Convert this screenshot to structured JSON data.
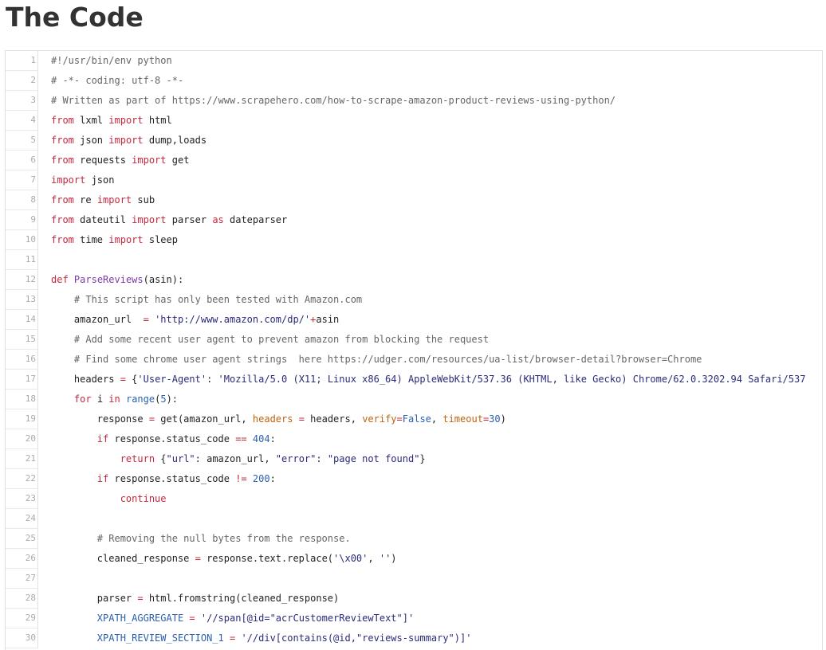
{
  "page": {
    "title": "The Code"
  },
  "code": {
    "lines": [
      {
        "n": "1",
        "tokens": [
          {
            "t": "cm",
            "v": "#!/usr/bin/env python"
          }
        ]
      },
      {
        "n": "2",
        "tokens": [
          {
            "t": "cm",
            "v": "# -*- coding: utf-8 -*-"
          }
        ]
      },
      {
        "n": "3",
        "tokens": [
          {
            "t": "cm",
            "v": "# Written as part of https://www.scrapehero.com/how-to-scrape-amazon-product-reviews-using-python/"
          }
        ]
      },
      {
        "n": "4",
        "tokens": [
          {
            "t": "kw",
            "v": "from"
          },
          {
            "t": "plain",
            "v": " lxml "
          },
          {
            "t": "kw",
            "v": "import"
          },
          {
            "t": "plain",
            "v": " html"
          }
        ]
      },
      {
        "n": "5",
        "tokens": [
          {
            "t": "kw",
            "v": "from"
          },
          {
            "t": "plain",
            "v": " json "
          },
          {
            "t": "kw",
            "v": "import"
          },
          {
            "t": "plain",
            "v": " dump,loads"
          }
        ]
      },
      {
        "n": "6",
        "tokens": [
          {
            "t": "kw",
            "v": "from"
          },
          {
            "t": "plain",
            "v": " requests "
          },
          {
            "t": "kw",
            "v": "import"
          },
          {
            "t": "plain",
            "v": " get"
          }
        ]
      },
      {
        "n": "7",
        "tokens": [
          {
            "t": "kw",
            "v": "import"
          },
          {
            "t": "plain",
            "v": " json"
          }
        ]
      },
      {
        "n": "8",
        "tokens": [
          {
            "t": "kw",
            "v": "from"
          },
          {
            "t": "plain",
            "v": " re "
          },
          {
            "t": "kw",
            "v": "import"
          },
          {
            "t": "plain",
            "v": " sub"
          }
        ]
      },
      {
        "n": "9",
        "tokens": [
          {
            "t": "kw",
            "v": "from"
          },
          {
            "t": "plain",
            "v": " dateutil "
          },
          {
            "t": "kw",
            "v": "import"
          },
          {
            "t": "plain",
            "v": " parser "
          },
          {
            "t": "kw",
            "v": "as"
          },
          {
            "t": "plain",
            "v": " dateparser"
          }
        ]
      },
      {
        "n": "10",
        "tokens": [
          {
            "t": "kw",
            "v": "from"
          },
          {
            "t": "plain",
            "v": " time "
          },
          {
            "t": "kw",
            "v": "import"
          },
          {
            "t": "plain",
            "v": " sleep"
          }
        ]
      },
      {
        "n": "11",
        "tokens": []
      },
      {
        "n": "12",
        "tokens": [
          {
            "t": "kw",
            "v": "def"
          },
          {
            "t": "plain",
            "v": " "
          },
          {
            "t": "fn",
            "v": "ParseReviews"
          },
          {
            "t": "plain",
            "v": "(asin):"
          }
        ]
      },
      {
        "n": "13",
        "tokens": [
          {
            "t": "plain",
            "v": "    "
          },
          {
            "t": "cm",
            "v": "# This script has only been tested with Amazon.com"
          }
        ]
      },
      {
        "n": "14",
        "tokens": [
          {
            "t": "plain",
            "v": "    amazon_url  "
          },
          {
            "t": "op",
            "v": "="
          },
          {
            "t": "plain",
            "v": " "
          },
          {
            "t": "str",
            "v": "'http://www.amazon.com/dp/'"
          },
          {
            "t": "op",
            "v": "+"
          },
          {
            "t": "plain",
            "v": "asin"
          }
        ]
      },
      {
        "n": "15",
        "tokens": [
          {
            "t": "plain",
            "v": "    "
          },
          {
            "t": "cm",
            "v": "# Add some recent user agent to prevent amazon from blocking the request"
          }
        ]
      },
      {
        "n": "16",
        "tokens": [
          {
            "t": "plain",
            "v": "    "
          },
          {
            "t": "cm",
            "v": "# Find some chrome user agent strings  here https://udger.com/resources/ua-list/browser-detail?browser=Chrome"
          }
        ]
      },
      {
        "n": "17",
        "tokens": [
          {
            "t": "plain",
            "v": "    headers "
          },
          {
            "t": "op",
            "v": "="
          },
          {
            "t": "plain",
            "v": " {"
          },
          {
            "t": "str",
            "v": "'User-Agent'"
          },
          {
            "t": "plain",
            "v": ": "
          },
          {
            "t": "str",
            "v": "'Mozilla/5.0 (X11; Linux x86_64) AppleWebKit/537.36 (KHTML, like Gecko) Chrome/62.0.3202.94 Safari/537"
          }
        ]
      },
      {
        "n": "18",
        "tokens": [
          {
            "t": "plain",
            "v": "    "
          },
          {
            "t": "kw",
            "v": "for"
          },
          {
            "t": "plain",
            "v": " i "
          },
          {
            "t": "kw",
            "v": "in"
          },
          {
            "t": "plain",
            "v": " "
          },
          {
            "t": "bi",
            "v": "range"
          },
          {
            "t": "plain",
            "v": "("
          },
          {
            "t": "num",
            "v": "5"
          },
          {
            "t": "plain",
            "v": "):"
          }
        ]
      },
      {
        "n": "19",
        "tokens": [
          {
            "t": "plain",
            "v": "        response "
          },
          {
            "t": "op",
            "v": "="
          },
          {
            "t": "plain",
            "v": " get(amazon_url, "
          },
          {
            "t": "kwarg",
            "v": "headers"
          },
          {
            "t": "plain",
            "v": " "
          },
          {
            "t": "op",
            "v": "="
          },
          {
            "t": "plain",
            "v": " headers, "
          },
          {
            "t": "kwarg",
            "v": "verify"
          },
          {
            "t": "op",
            "v": "="
          },
          {
            "t": "const",
            "v": "False"
          },
          {
            "t": "plain",
            "v": ", "
          },
          {
            "t": "kwarg",
            "v": "timeout"
          },
          {
            "t": "op",
            "v": "="
          },
          {
            "t": "num",
            "v": "30"
          },
          {
            "t": "plain",
            "v": ")"
          }
        ]
      },
      {
        "n": "20",
        "tokens": [
          {
            "t": "plain",
            "v": "        "
          },
          {
            "t": "kw",
            "v": "if"
          },
          {
            "t": "plain",
            "v": " response.status_code "
          },
          {
            "t": "op",
            "v": "=="
          },
          {
            "t": "plain",
            "v": " "
          },
          {
            "t": "num",
            "v": "404"
          },
          {
            "t": "plain",
            "v": ":"
          }
        ]
      },
      {
        "n": "21",
        "tokens": [
          {
            "t": "plain",
            "v": "            "
          },
          {
            "t": "kw",
            "v": "return"
          },
          {
            "t": "plain",
            "v": " {"
          },
          {
            "t": "str",
            "v": "\"url\""
          },
          {
            "t": "plain",
            "v": ": amazon_url, "
          },
          {
            "t": "str",
            "v": "\"error\""
          },
          {
            "t": "plain",
            "v": ": "
          },
          {
            "t": "str",
            "v": "\"page not found\""
          },
          {
            "t": "plain",
            "v": "}"
          }
        ]
      },
      {
        "n": "22",
        "tokens": [
          {
            "t": "plain",
            "v": "        "
          },
          {
            "t": "kw",
            "v": "if"
          },
          {
            "t": "plain",
            "v": " response.status_code "
          },
          {
            "t": "op",
            "v": "!="
          },
          {
            "t": "plain",
            "v": " "
          },
          {
            "t": "num",
            "v": "200"
          },
          {
            "t": "plain",
            "v": ":"
          }
        ]
      },
      {
        "n": "23",
        "tokens": [
          {
            "t": "plain",
            "v": "            "
          },
          {
            "t": "kw",
            "v": "continue"
          }
        ]
      },
      {
        "n": "24",
        "tokens": []
      },
      {
        "n": "25",
        "tokens": [
          {
            "t": "plain",
            "v": "        "
          },
          {
            "t": "cm",
            "v": "# Removing the null bytes from the response."
          }
        ]
      },
      {
        "n": "26",
        "tokens": [
          {
            "t": "plain",
            "v": "        cleaned_response "
          },
          {
            "t": "op",
            "v": "="
          },
          {
            "t": "plain",
            "v": " response.text.replace("
          },
          {
            "t": "str",
            "v": "'\\x00'"
          },
          {
            "t": "plain",
            "v": ", "
          },
          {
            "t": "str",
            "v": "''"
          },
          {
            "t": "plain",
            "v": ")"
          }
        ]
      },
      {
        "n": "27",
        "tokens": []
      },
      {
        "n": "28",
        "tokens": [
          {
            "t": "plain",
            "v": "        parser "
          },
          {
            "t": "op",
            "v": "="
          },
          {
            "t": "plain",
            "v": " html.fromstring(cleaned_response)"
          }
        ]
      },
      {
        "n": "29",
        "tokens": [
          {
            "t": "plain",
            "v": "        "
          },
          {
            "t": "const",
            "v": "XPATH_AGGREGATE"
          },
          {
            "t": "plain",
            "v": " "
          },
          {
            "t": "op",
            "v": "="
          },
          {
            "t": "plain",
            "v": " "
          },
          {
            "t": "str",
            "v": "'//span[@id=\"acrCustomerReviewText\"]'"
          }
        ]
      },
      {
        "n": "30",
        "tokens": [
          {
            "t": "plain",
            "v": "        "
          },
          {
            "t": "const",
            "v": "XPATH_REVIEW_SECTION_1"
          },
          {
            "t": "plain",
            "v": " "
          },
          {
            "t": "op",
            "v": "="
          },
          {
            "t": "plain",
            "v": " "
          },
          {
            "t": "str",
            "v": "'//div[contains(@id,\"reviews-summary\")]'"
          }
        ]
      }
    ]
  }
}
